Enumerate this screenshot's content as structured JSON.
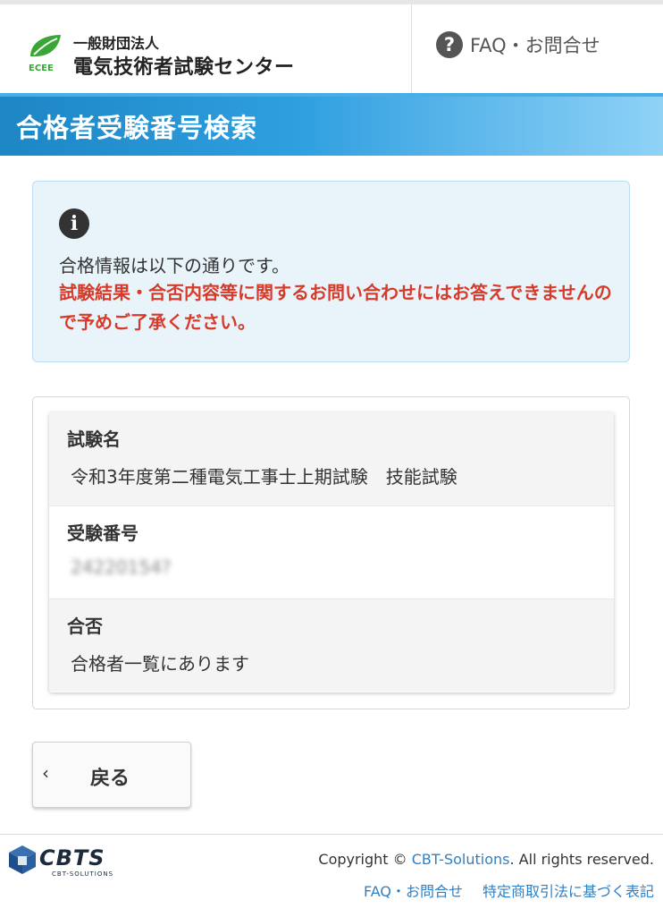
{
  "header": {
    "org_sub": "一般財団法人",
    "org_main": "電気技術者試験センター",
    "logo_text": "ECEE",
    "faq_icon": "question-circle-icon",
    "faq_label": "FAQ・お問合せ"
  },
  "page_title": "合格者受験番号検索",
  "alert": {
    "icon": "info-circle-icon",
    "message": "合格情報は以下の通りです。",
    "warning": "試験結果・合否内容等に関するお問い合わせにはお答えできませんので予めご了承ください。"
  },
  "result": {
    "rows": [
      {
        "label": "試験名",
        "value": "令和3年度第二種電気工事士上期試験　技能試験"
      },
      {
        "label": "受験番号",
        "value": "24220154?"
      },
      {
        "label": "合否",
        "value": "合格者一覧にあります"
      }
    ]
  },
  "back_button": {
    "icon": "chevron-left-icon",
    "label": "戻る"
  },
  "footer": {
    "brand": "CBTS",
    "brand_sub": "CBT-SOLUTIONS",
    "copyright_prefix": "Copyright © ",
    "copyright_link": "CBT-Solutions",
    "copyright_suffix": ". All rights reserved.",
    "link_faq": "FAQ・お問合せ",
    "link_law": "特定商取引法に基づく表記"
  },
  "colors": {
    "title_band": "#1d86c5",
    "warning_text": "#d83a2a",
    "link": "#2f7fc4",
    "logo_green": "#3aa636"
  }
}
